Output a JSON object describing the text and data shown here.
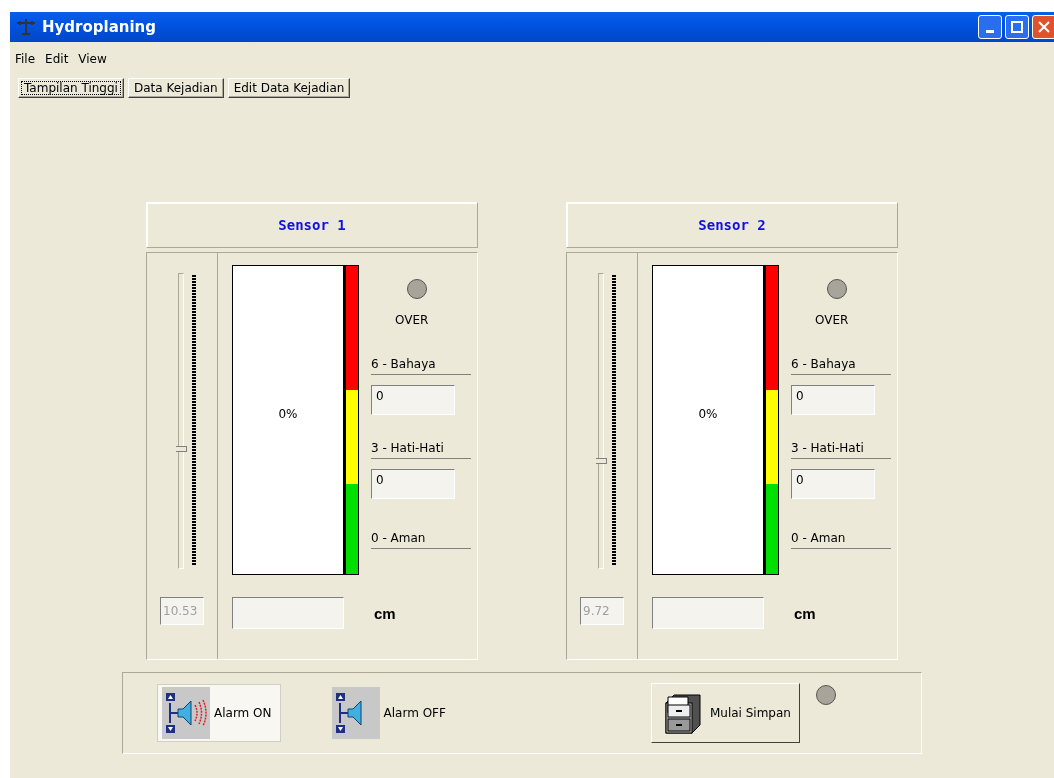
{
  "window": {
    "title": "Hydroplaning"
  },
  "menu": [
    "File",
    "Edit",
    "View"
  ],
  "tabs": [
    {
      "label": "Tampilan Tinggi",
      "selected": true
    },
    {
      "label": "Data Kejadian",
      "selected": false
    },
    {
      "label": "Edit Data Kejadian",
      "selected": false
    }
  ],
  "sensors": [
    {
      "title": "Sensor 1",
      "slider": {
        "level": 0.4
      },
      "reading": "10.53",
      "gauge": {
        "percent": "0%"
      },
      "over": {
        "label": "OVER",
        "lit": false
      },
      "zones": [
        {
          "color": "#ff0000",
          "label": "6 -  Bahaya",
          "value": "0"
        },
        {
          "color": "#ffff00",
          "label": "3 -  Hati-Hati",
          "value": "0"
        },
        {
          "color": "#00e000",
          "label": "0 - Aman"
        }
      ],
      "unit": "cm"
    },
    {
      "title": "Sensor 2",
      "slider": {
        "level": 0.36
      },
      "reading": "9.72",
      "gauge": {
        "percent": "0%"
      },
      "over": {
        "label": "OVER",
        "lit": false
      },
      "zones": [
        {
          "color": "#ff0000",
          "label": "6 -  Bahaya",
          "value": "0"
        },
        {
          "color": "#ffff00",
          "label": "3 -  Hati-Hati",
          "value": "0"
        },
        {
          "color": "#00e000",
          "label": "0 - Aman"
        }
      ],
      "unit": "cm"
    }
  ],
  "controls": {
    "alarm_on": {
      "label": "Alarm ON",
      "selected": true
    },
    "alarm_off": {
      "label": "Alarm OFF",
      "selected": false
    },
    "save": {
      "label": "Mulai Simpan"
    },
    "save_led": {
      "lit": false
    }
  }
}
